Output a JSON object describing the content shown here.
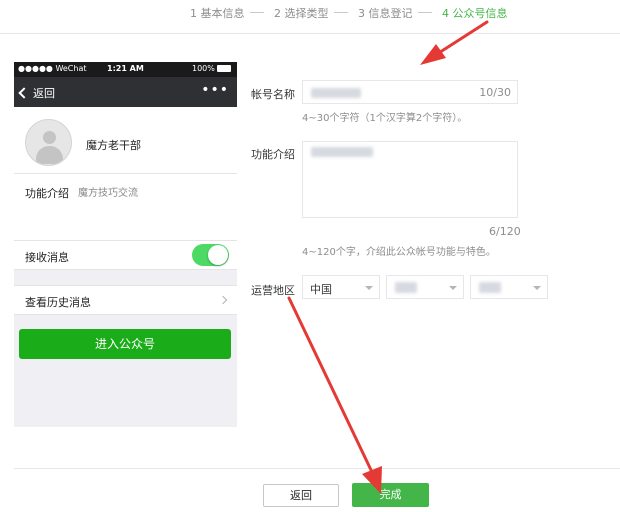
{
  "steps": [
    {
      "label": "1 基本信息",
      "active": false
    },
    {
      "label": "2 选择类型",
      "active": false
    },
    {
      "label": "3 信息登记",
      "active": false
    },
    {
      "label": "4 公众号信息",
      "active": true
    }
  ],
  "phone_preview": {
    "status_bar": {
      "carrier": "●●●●● WeChat",
      "time": "1:21 AM",
      "battery": "100%"
    },
    "nav": {
      "back_label": "返回",
      "more_icon": "•••"
    },
    "account_name": "魔方老干部",
    "function_label": "功能介绍",
    "function_value": "魔方技巧交流",
    "receive_messages_label": "接收消息",
    "receive_messages_on": true,
    "history_label": "查看历史消息",
    "enter_button_label": "进入公众号"
  },
  "form": {
    "account_name": {
      "label": "帐号名称",
      "counter": "10/30",
      "tip": "4~30个字符（1个汉字算2个字符）。"
    },
    "description": {
      "label": "功能介绍",
      "counter": "6/120",
      "tip": "4~120个字，介绍此公众帐号功能与特色。"
    },
    "region": {
      "label": "运营地区",
      "country": "中国"
    }
  },
  "footer": {
    "back_label": "返回",
    "done_label": "完成"
  },
  "colors": {
    "accent": "#44b549",
    "wechat_green": "#1aad19",
    "arrow_red": "#e53935"
  }
}
